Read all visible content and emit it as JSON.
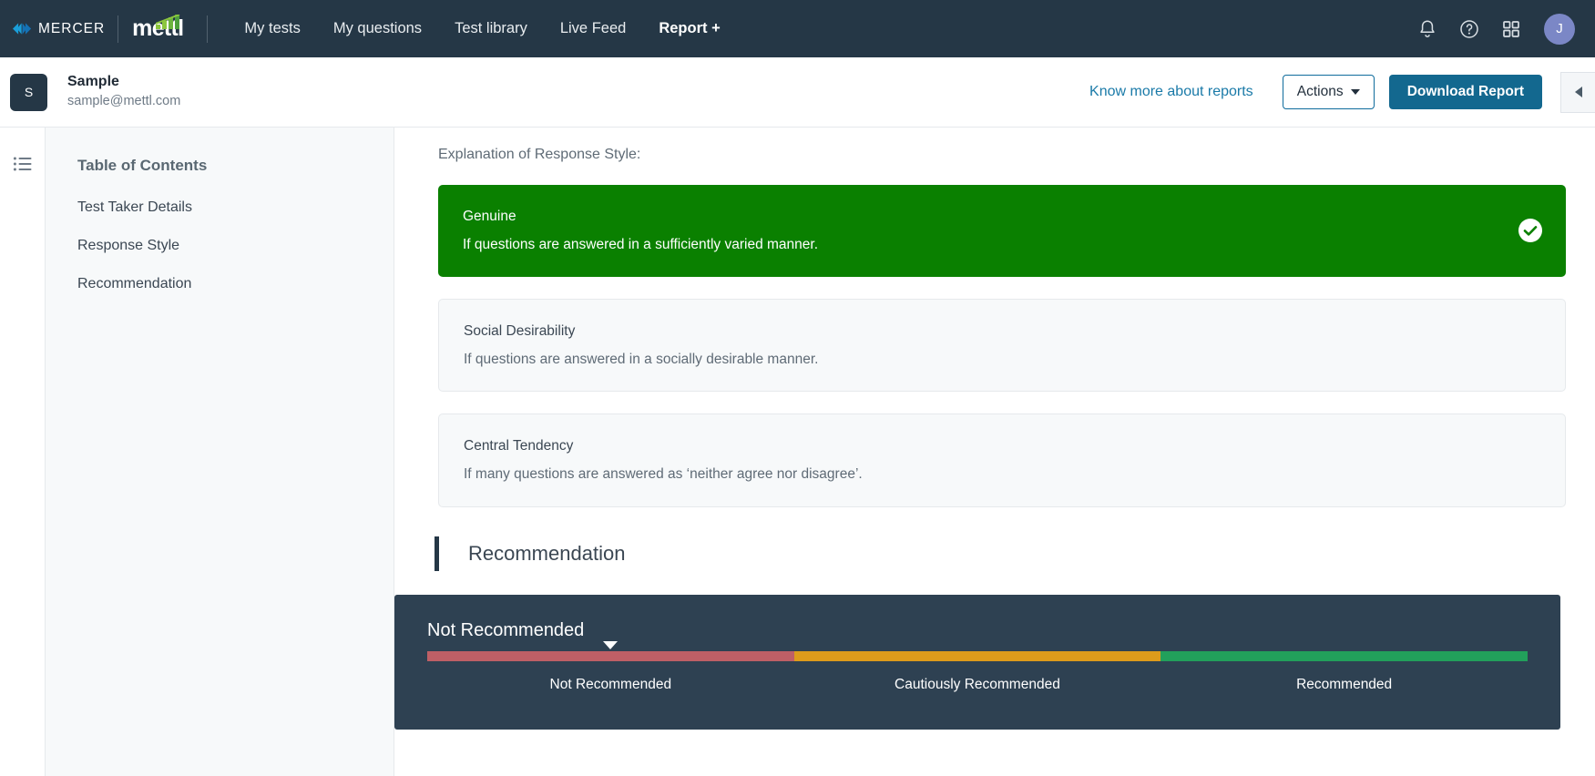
{
  "topnav": {
    "brand": {
      "mercer": "MERCER",
      "mettl": "mettl"
    },
    "links": [
      {
        "label": "My tests",
        "active": false
      },
      {
        "label": "My questions",
        "active": false
      },
      {
        "label": "Test library",
        "active": false
      },
      {
        "label": "Live Feed",
        "active": false
      },
      {
        "label": "Report +",
        "active": true
      }
    ],
    "icons": [
      {
        "name": "notification-bell-icon"
      },
      {
        "name": "help-circle-icon"
      },
      {
        "name": "app-grid-icon"
      }
    ],
    "avatar_initial": "J",
    "avatar_color": "#7b87c6",
    "background_color": "#253746"
  },
  "subheader": {
    "candidate_initial": "S",
    "candidate_name": "Sample",
    "candidate_email": "sample@mettl.com",
    "know_more_label": "Know more about reports",
    "actions_label": "Actions",
    "download_label": "Download Report",
    "download_color": "#13688f",
    "collapse_icon": "chevron-left-icon"
  },
  "sidebar": {
    "rail_icon": "list-icon",
    "toc_title": "Table of Contents",
    "items": [
      {
        "label": "Test Taker Details"
      },
      {
        "label": "Response Style"
      },
      {
        "label": "Recommendation"
      }
    ]
  },
  "main": {
    "explanation_label": "Explanation of Response Style:",
    "response_styles": [
      {
        "title": "Genuine",
        "description": "If questions are answered in a sufficiently varied manner.",
        "selected": true,
        "color": "#0a8000",
        "badge_icon": "check-circle-icon"
      },
      {
        "title": "Social Desirability",
        "description": "If questions are answered in a socially desirable manner.",
        "selected": false,
        "color": "#f7f9fa"
      },
      {
        "title": "Central Tendency",
        "description": "If many questions are answered as ‘neither agree nor disagree’.",
        "selected": false,
        "color": "#f7f9fa"
      }
    ],
    "recommendation": {
      "section_title": "Recommendation",
      "verdict": "Not Recommended",
      "panel_color": "#2e4152",
      "marker_position_percent": 16.6,
      "scale": [
        {
          "label": "Not Recommended",
          "color": "#bf5f66",
          "width_percent": 33.33
        },
        {
          "label": "Cautiously Recommended",
          "color": "#dd9b1b",
          "width_percent": 33.33
        },
        {
          "label": "Recommended",
          "color": "#22a05b",
          "width_percent": 33.34
        }
      ]
    }
  }
}
